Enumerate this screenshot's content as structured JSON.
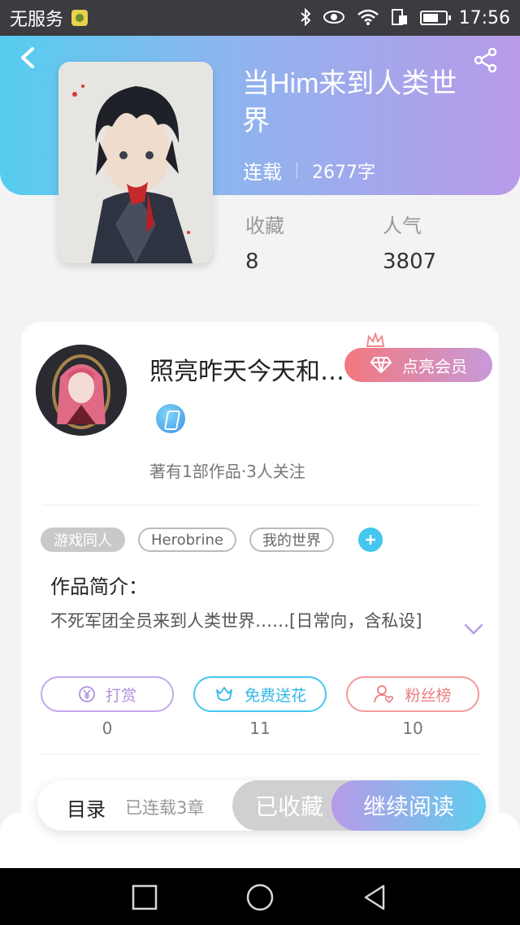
{
  "status_bar": {
    "carrier": "无服务",
    "time": "17:56",
    "icons": [
      "sim-icon",
      "bluetooth-icon",
      "eye-icon",
      "wifi-icon",
      "data-icon",
      "battery-icon"
    ]
  },
  "header": {
    "back_icon": "chevron-left-icon",
    "share_icon": "share-icon",
    "book_title": "当Him来到人类世界",
    "status": "连载",
    "word_count": "2677字",
    "colors": {
      "gradient_start": "#56cdef",
      "gradient_end": "#b89ae8"
    }
  },
  "stats": {
    "favorites_label": "收藏",
    "favorites_value": "8",
    "popularity_label": "人气",
    "popularity_value": "3807"
  },
  "author": {
    "name": "照亮昨天今天和…",
    "vip_label": "点亮会员",
    "works": "著有1部作品·3人关注"
  },
  "tags": [
    "游戏同人",
    "Herobrine",
    "我的世界"
  ],
  "intro": {
    "title": "作品简介：",
    "text": "不死军团全员来到人类世界……[日常向，含私设]"
  },
  "actions": [
    {
      "label": "打赏",
      "icon": "yen-icon",
      "count": "0",
      "color": "#b89ae8"
    },
    {
      "label": "免费送花",
      "icon": "flower-icon",
      "count": "11",
      "color": "#45c6ee"
    },
    {
      "label": "粉丝榜",
      "icon": "fans-icon",
      "count": "10",
      "color": "#f08a8e"
    }
  ],
  "bottom_bar": {
    "toc_label": "目录",
    "chapters": "已连载3章",
    "collected": "已收藏",
    "continue_reading": "继续阅读"
  }
}
